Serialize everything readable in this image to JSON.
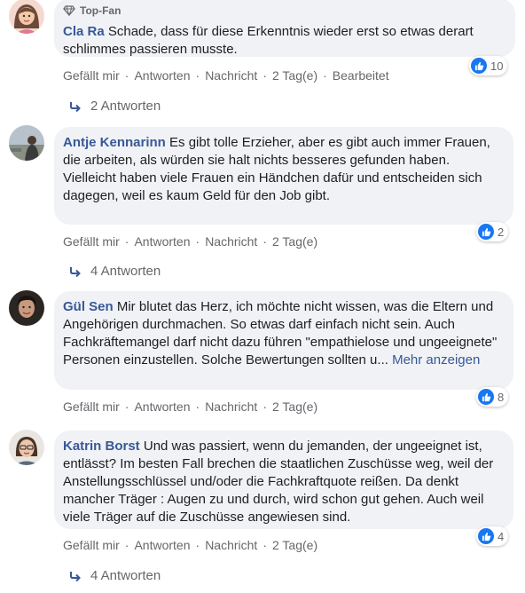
{
  "actions": {
    "like": "Gefällt mir",
    "reply": "Antworten",
    "message": "Nachricht",
    "edited": "Bearbeitet"
  },
  "comments": [
    {
      "author": "Cla Ra",
      "badge": "Top-Fan",
      "text": "Schade, dass für diese Erkenntnis wieder erst so etwas derart schlimmes passieren musste.",
      "reactions": "10",
      "time": "2 Tag(e)",
      "replies": "2 Antworten"
    },
    {
      "author": "Antje Kennarinn",
      "text": "Es gibt tolle Erzieher, aber es gibt auch immer Frauen, die arbeiten, als würden sie halt nichts besseres gefunden haben.\nVielleicht haben viele Frauen ein Händchen dafür und entscheiden sich dagegen, weil es kaum Geld für den Job gibt.",
      "reactions": "2",
      "time": "2 Tag(e)",
      "replies": "4 Antworten"
    },
    {
      "author": "Gül Sen",
      "text": "Mir blutet das Herz, ich möchte nicht wissen, was die Eltern und Angehörigen durchmachen. So etwas darf einfach nicht sein. Auch Fachkräftemangel darf nicht dazu führen \"empathielose und ungeeignete\" Personen einzustellen. Solche Bewertungen sollten u...",
      "more": "Mehr anzeigen",
      "reactions": "8",
      "time": "2 Tag(e)"
    },
    {
      "author": "Katrin Borst",
      "text": "Und was passiert, wenn du jemanden, der ungeeignet ist, entlässt? Im besten Fall brechen die staatlichen Zuschüsse weg, weil der Anstellungsschlüssel und/oder die Fachkraftquote reißen. Da denkt mancher Träger : Augen zu und durch, wird schon gut gehen. Auch weil viele Träger auf die Zuschüsse angewiesen sind.",
      "reactions": "4",
      "time": "2 Tag(e)",
      "replies": "4 Antworten"
    }
  ],
  "colors": {
    "link": "#385898",
    "meta": "#65676b",
    "bubble": "#f0f2f5",
    "like": "#1877f2"
  },
  "icons": {
    "badge": "diamond-icon",
    "like": "like-thumb-icon",
    "reply": "reply-arrow-icon"
  }
}
